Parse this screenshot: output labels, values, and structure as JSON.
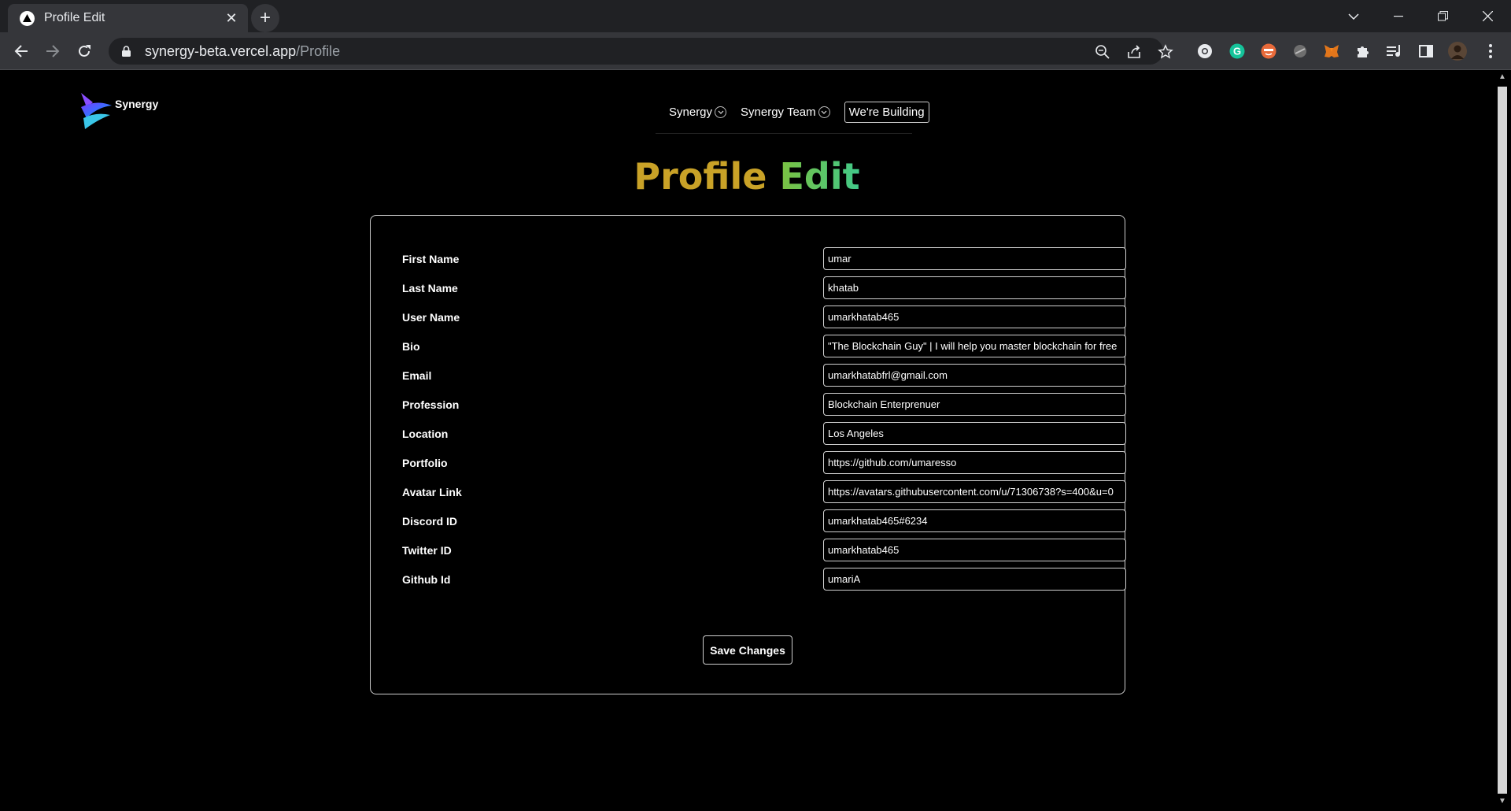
{
  "browser": {
    "tab_title": "Profile Edit",
    "new_tab_label": "+",
    "url_host": "synergy-beta.vercel.app",
    "url_path": "/Profile"
  },
  "site": {
    "logo_text": "Synergy",
    "nav": [
      {
        "label": "Synergy"
      },
      {
        "label": "Synergy Team"
      }
    ],
    "building_button": "We're Building"
  },
  "page": {
    "title_part1": "Profile",
    "title_part2": "Edit",
    "colors": {
      "title_gold": "#c9a227",
      "title_green": "#7cc140"
    }
  },
  "form": {
    "fields": [
      {
        "label": "First Name",
        "value": "umar"
      },
      {
        "label": "Last Name",
        "value": "khatab"
      },
      {
        "label": "User Name",
        "value": "umarkhatab465"
      },
      {
        "label": "Bio",
        "value": "\"The Blockchain Guy\" | I will help you master blockchain for free"
      },
      {
        "label": "Email",
        "value": "umarkhatabfrl@gmail.com"
      },
      {
        "label": "Profession",
        "value": "Blockchain Enterprenuer"
      },
      {
        "label": "Location",
        "value": "Los Angeles"
      },
      {
        "label": "Portfolio",
        "value": "https://github.com/umaresso"
      },
      {
        "label": "Avatar Link",
        "value": "https://avatars.githubusercontent.com/u/71306738?s=400&u=0"
      },
      {
        "label": "Discord ID",
        "value": "umarkhatab465#6234"
      },
      {
        "label": "Twitter ID",
        "value": "umarkhatab465"
      },
      {
        "label": "Github Id",
        "value": "umariA"
      }
    ],
    "save_label": "Save Changes"
  }
}
